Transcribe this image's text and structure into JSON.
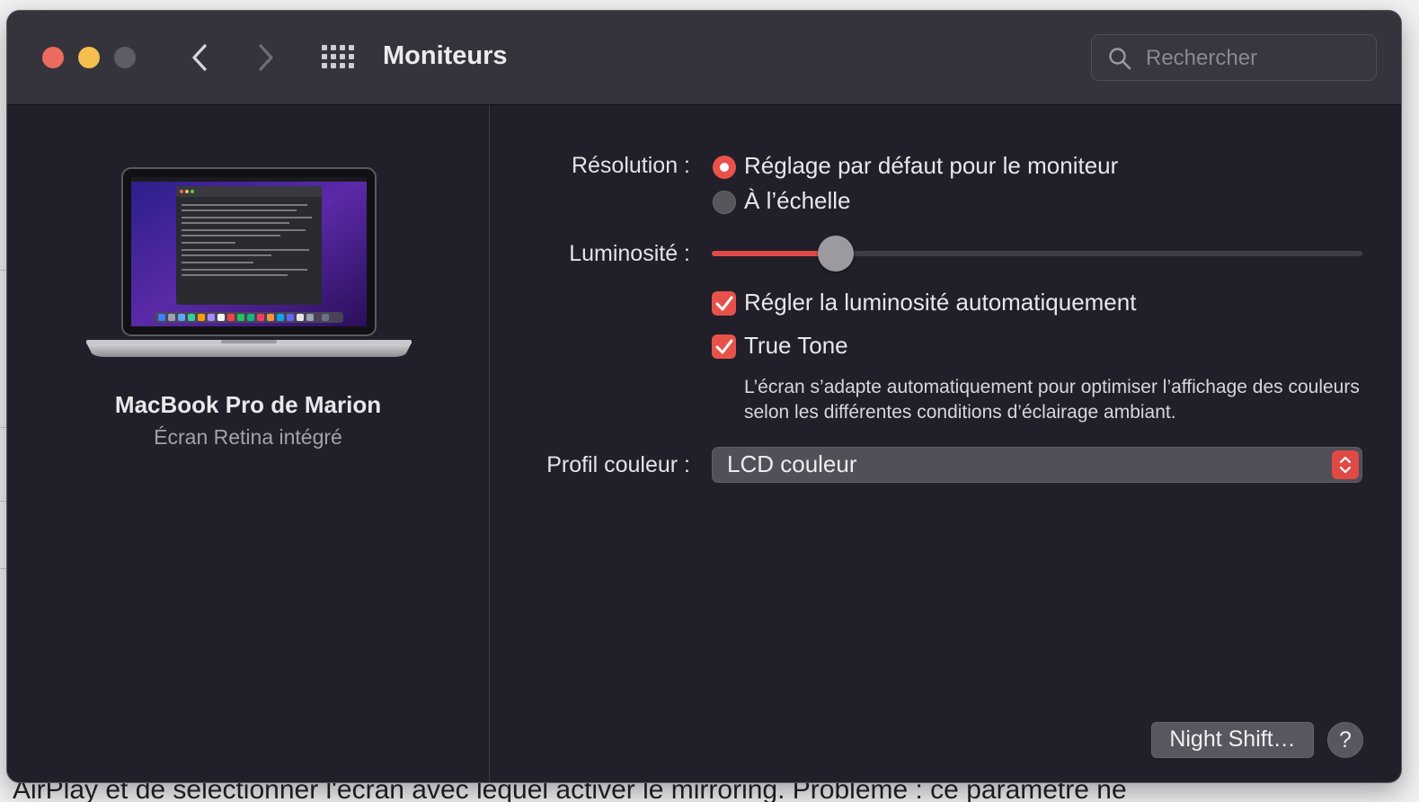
{
  "window": {
    "title": "Moniteurs",
    "search_placeholder": "Rechercher"
  },
  "device": {
    "name": "MacBook Pro de Marion",
    "subtitle": "Écran Retina intégré"
  },
  "settings": {
    "resolution_label": "Résolution :",
    "resolution_options": [
      {
        "label": "Réglage par défaut pour le moniteur",
        "selected": true
      },
      {
        "label": "À l’échelle",
        "selected": false
      }
    ],
    "brightness_label": "Luminosité :",
    "brightness_value": 0.19,
    "auto_brightness_label": "Régler la luminosité automatiquement",
    "auto_brightness_checked": true,
    "true_tone_label": "True Tone",
    "true_tone_checked": true,
    "true_tone_description": "L’écran s’adapte automatiquement pour optimiser l’affichage des couleurs selon les différentes conditions d’éclairage ambiant.",
    "color_profile_label": "Profil couleur :",
    "color_profile_value": "LCD couleur"
  },
  "footer": {
    "night_shift_label": "Night Shift…",
    "help_label": "?"
  },
  "background_page": {
    "text": "AirPlay et de sélectionner l'écran avec lequel activer le mirroring. Problème : ce paramètre ne"
  },
  "colors": {
    "accent": "#e6524a",
    "window_bg": "#211f29",
    "titlebar_bg": "#35333b"
  }
}
